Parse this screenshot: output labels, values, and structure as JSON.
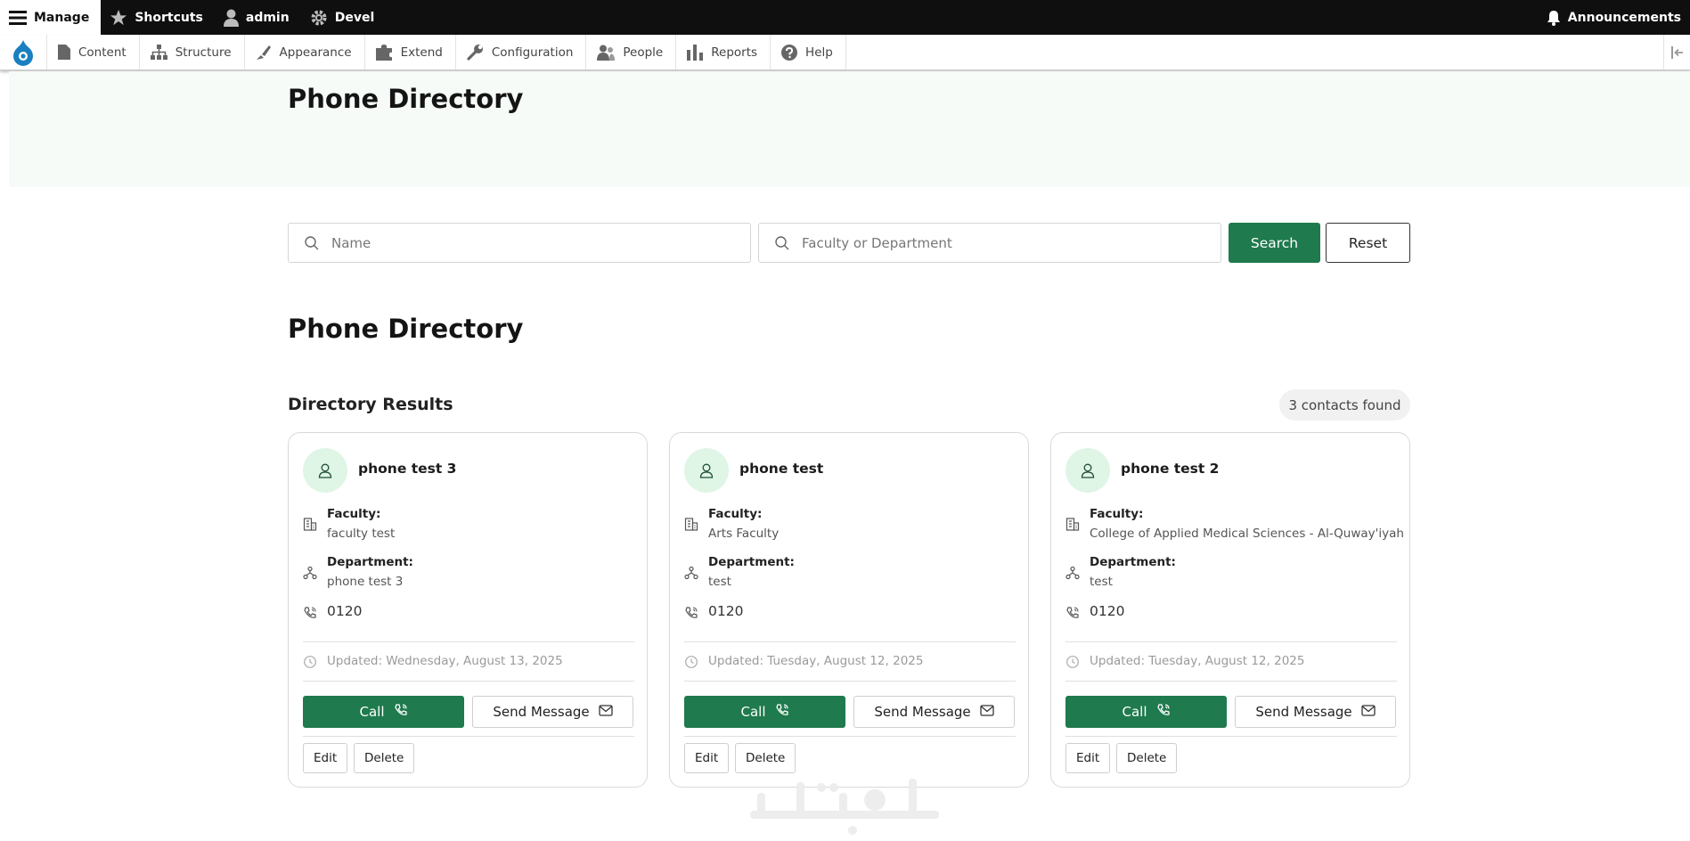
{
  "toolbar": {
    "manage": "Manage",
    "shortcuts": "Shortcuts",
    "user": "admin",
    "devel": "Devel",
    "announcements": "Announcements"
  },
  "tray": {
    "items": [
      "Content",
      "Structure",
      "Appearance",
      "Extend",
      "Configuration",
      "People",
      "Reports",
      "Help"
    ]
  },
  "page": {
    "hero_title": "Phone Directory",
    "section_title": "Phone Directory",
    "results_title": "Directory Results",
    "count": "3 contacts found"
  },
  "search": {
    "name_placeholder": "Name",
    "faculty_placeholder": "Faculty or Department",
    "search_label": "Search",
    "reset_label": "Reset"
  },
  "labels": {
    "faculty": "Faculty:",
    "department": "Department:",
    "call": "Call",
    "send_message": "Send Message",
    "edit": "Edit",
    "delete": "Delete"
  },
  "contacts": [
    {
      "name": "phone test 3",
      "faculty": "faculty test",
      "department": "phone test 3",
      "phone": "0120",
      "updated": "Updated: Wednesday, August 13, 2025"
    },
    {
      "name": "phone test",
      "faculty": "Arts Faculty",
      "department": "test",
      "phone": "0120",
      "updated": "Updated: Tuesday, August 12, 2025"
    },
    {
      "name": "phone test 2",
      "faculty": "College of Applied Medical Sciences - Al-Quway'iyah",
      "department": "test",
      "phone": "0120",
      "updated": "Updated: Tuesday, August 12, 2025"
    }
  ],
  "watermark": "خمسات",
  "colors": {
    "primary": "#1f7a4d",
    "hero_bg": "#f6fbf7",
    "avatar_bg": "#dff5e6"
  },
  "icons": [
    "hamburger-icon",
    "star-icon",
    "user-icon",
    "gear-icon",
    "bell-icon",
    "drupal-logo-icon",
    "search-icon",
    "person-icon",
    "building-icon",
    "hierarchy-icon",
    "phone-icon",
    "clock-icon",
    "envelope-icon"
  ]
}
